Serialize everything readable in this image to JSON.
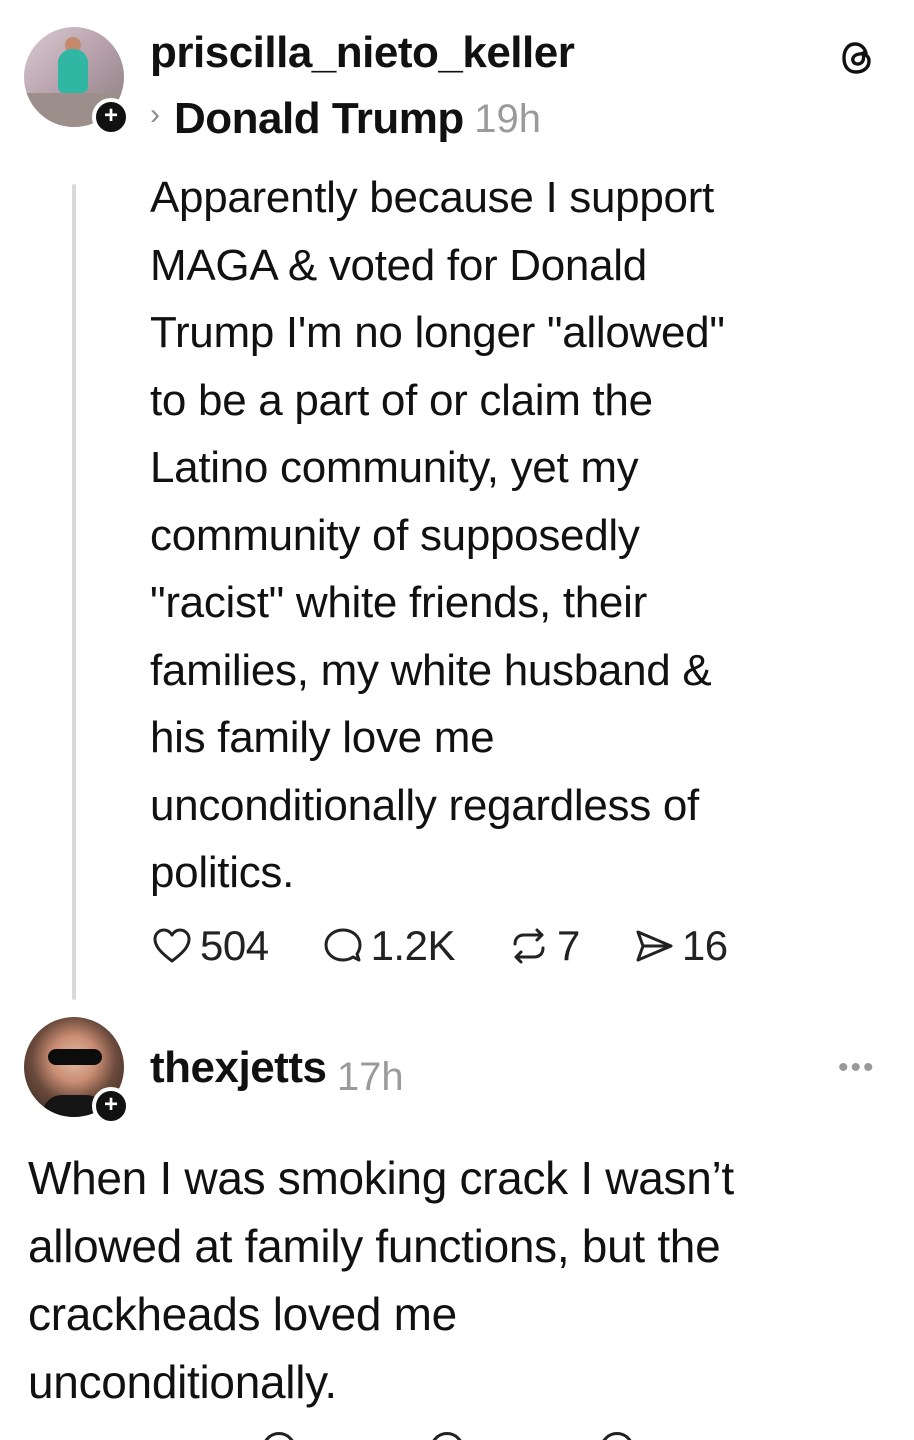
{
  "post": {
    "username": "priscilla_nieto_keller",
    "reply_to": "Donald Trump",
    "time": "19h",
    "text": "Apparently because I support\nMAGA & voted for Donald\nTrump I'm no longer \"allowed\"\nto be a part of or claim the\nLatino community, yet my\ncommunity of supposedly\n\"racist\" white friends, their\nfamilies, my white husband &\nhis family love me\nunconditionally regardless of\npolitics.",
    "likes": "504",
    "comments": "1.2K",
    "reposts": "7",
    "shares": "16",
    "follow_badge": "+"
  },
  "reply": {
    "username": "thexjetts",
    "time": "17h",
    "text": "When I was smoking crack I wasn’t\nallowed at family functions, but the\ncrackheads loved me\nunconditionally.",
    "follow_badge": "+"
  },
  "icons": {
    "app_logo": "threads-logo-icon",
    "chevron": "chevron-right-icon",
    "like": "heart-icon",
    "comment": "comment-icon",
    "repost": "repost-icon",
    "share": "send-icon",
    "more": "more-icon"
  }
}
